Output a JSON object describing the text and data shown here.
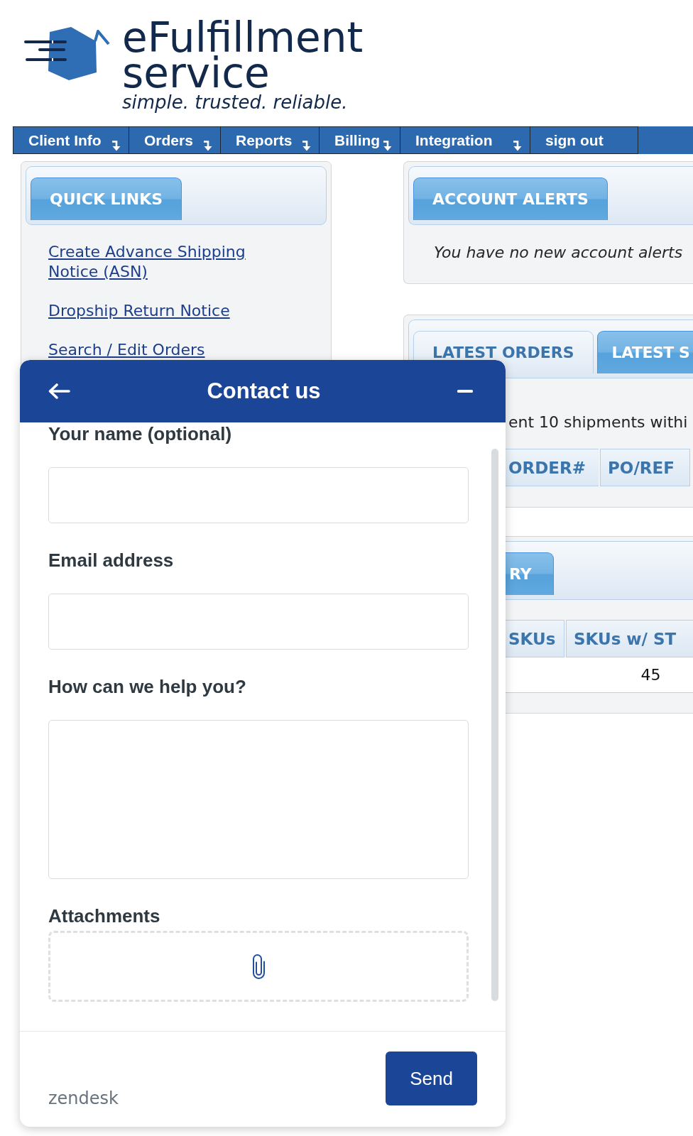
{
  "logo": {
    "name": "eFulfillment",
    "name_line_2": "service",
    "tagline": "simple. trusted. reliable."
  },
  "nav": [
    {
      "label": "Client Info",
      "dropdown": true
    },
    {
      "label": "Orders",
      "dropdown": true
    },
    {
      "label": "Reports",
      "dropdown": true
    },
    {
      "label": "Billing",
      "dropdown": true
    },
    {
      "label": "Integration",
      "dropdown": true
    },
    {
      "label": "sign out",
      "dropdown": false
    }
  ],
  "quick_links": {
    "title": "QUICK LINKS",
    "links": [
      "Create Advance Shipping Notice (ASN)",
      "Dropship Return Notice",
      "Search / Edit Orders"
    ]
  },
  "account_alerts": {
    "title": "ACCOUNT ALERTS",
    "message": "You have no new account alerts"
  },
  "orders_panel": {
    "tabs": [
      {
        "label": "LATEST ORDERS",
        "selected": false
      },
      {
        "label": "LATEST S",
        "selected": true
      }
    ],
    "note": "ent 10 shipments withi",
    "columns": [
      "ORDER#",
      "PO/REF"
    ]
  },
  "sku_panel": {
    "tabs": [
      {
        "label": "RY",
        "selected": true
      }
    ],
    "columns": [
      {
        "label": "SKUs"
      },
      {
        "label": "SKUs w/ ST",
        "cells": [
          "45"
        ]
      }
    ]
  },
  "contact_widget": {
    "title": "Contact us",
    "fields": [
      {
        "kind": "input",
        "label": "Your name (optional)"
      },
      {
        "kind": "input",
        "label": "Email address"
      },
      {
        "kind": "textarea",
        "label": "How can we help you?"
      },
      {
        "kind": "attachments",
        "label": "Attachments"
      }
    ],
    "brand": "zendesk",
    "send_button": "Send"
  }
}
